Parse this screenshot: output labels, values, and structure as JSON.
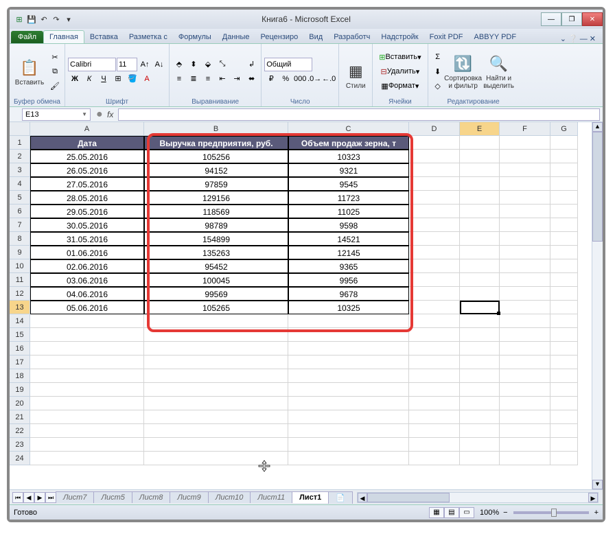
{
  "title": "Книга6 - Microsoft Excel",
  "qat": {
    "save": "💾",
    "undo": "↶",
    "redo": "↷",
    "more": "▾"
  },
  "winbtns": {
    "min": "—",
    "max": "❐",
    "close": "✕"
  },
  "tabs": {
    "file": "Файл",
    "items": [
      "Главная",
      "Вставка",
      "Разметка с",
      "Формулы",
      "Данные",
      "Рецензиро",
      "Вид",
      "Разработч",
      "Надстройк",
      "Foxit PDF",
      "ABBYY PDF"
    ],
    "active": 0,
    "help": "⌄ ❔ — ✕"
  },
  "ribbon": {
    "clipboard": {
      "label": "Буфер обмена",
      "paste": "Вставить",
      "cut": "✂",
      "copy": "⧉",
      "brush": "🖌"
    },
    "font": {
      "label": "Шрифт",
      "name": "Calibri",
      "size": "11",
      "bold": "Ж",
      "italic": "К",
      "underline": "Ч",
      "border": "⊞",
      "fill": "🪣",
      "color": "A",
      "grow": "A↑",
      "shrink": "A↓"
    },
    "align": {
      "label": "Выравнивание",
      "wrap": "↲",
      "merge": "⬌"
    },
    "number": {
      "label": "Число",
      "format": "Общий",
      "currency": "₽",
      "percent": "%",
      "comma": "000",
      "inc": ".0→",
      "dec": "←.0"
    },
    "styles": {
      "label": "",
      "btn": "Стили",
      "cond": "▦"
    },
    "cells": {
      "label": "Ячейки",
      "insert": "Вставить",
      "delete": "Удалить",
      "format": "Формат"
    },
    "editing": {
      "label": "Редактирование",
      "sum": "Σ",
      "fill": "⬇",
      "clear": "◇",
      "sort": "Сортировка\nи фильтр",
      "find": "Найти и\nвыделить"
    }
  },
  "namebox": "E13",
  "fx": "fx",
  "columns": [
    "A",
    "B",
    "C",
    "D",
    "E",
    "F",
    "G"
  ],
  "headers": {
    "A": "Дата",
    "B": "Выручка предприятия, руб.",
    "C": "Объем продаж зерна, т"
  },
  "rows": [
    {
      "n": 1
    },
    {
      "n": 2,
      "A": "25.05.2016",
      "B": "105256",
      "C": "10323"
    },
    {
      "n": 3,
      "A": "26.05.2016",
      "B": "94152",
      "C": "9321"
    },
    {
      "n": 4,
      "A": "27.05.2016",
      "B": "97859",
      "C": "9545"
    },
    {
      "n": 5,
      "A": "28.05.2016",
      "B": "129156",
      "C": "11723"
    },
    {
      "n": 6,
      "A": "29.05.2016",
      "B": "118569",
      "C": "11025"
    },
    {
      "n": 7,
      "A": "30.05.2016",
      "B": "98789",
      "C": "9598"
    },
    {
      "n": 8,
      "A": "31.05.2016",
      "B": "154899",
      "C": "14521"
    },
    {
      "n": 9,
      "A": "01.06.2016",
      "B": "135263",
      "C": "12145"
    },
    {
      "n": 10,
      "A": "02.06.2016",
      "B": "95452",
      "C": "9365"
    },
    {
      "n": 11,
      "A": "03.06.2016",
      "B": "100045",
      "C": "9956"
    },
    {
      "n": 12,
      "A": "04.06.2016",
      "B": "99569",
      "C": "9678"
    },
    {
      "n": 13,
      "A": "05.06.2016",
      "B": "105265",
      "C": "10325"
    }
  ],
  "empty_rows": [
    14,
    15,
    16,
    17,
    18,
    19,
    20,
    21,
    22,
    23,
    24
  ],
  "sheets": {
    "nav": [
      "⏮",
      "◀",
      "▶",
      "⏭"
    ],
    "tabs": [
      "Лист7",
      "Лист5",
      "Лист8",
      "Лист9",
      "Лист10",
      "Лист11",
      "Лист1"
    ],
    "active": 6,
    "add": "+"
  },
  "status": {
    "ready": "Готово",
    "zoom": "100%",
    "minus": "−",
    "plus": "+"
  },
  "active_cell": "E13",
  "chart_data": {
    "type": "table",
    "columns": [
      "Дата",
      "Выручка предприятия, руб.",
      "Объем продаж зерна, т"
    ],
    "data": [
      [
        "25.05.2016",
        105256,
        10323
      ],
      [
        "26.05.2016",
        94152,
        9321
      ],
      [
        "27.05.2016",
        97859,
        9545
      ],
      [
        "28.05.2016",
        129156,
        11723
      ],
      [
        "29.05.2016",
        118569,
        11025
      ],
      [
        "30.05.2016",
        98789,
        9598
      ],
      [
        "31.05.2016",
        154899,
        14521
      ],
      [
        "01.06.2016",
        135263,
        12145
      ],
      [
        "02.06.2016",
        95452,
        9365
      ],
      [
        "03.06.2016",
        100045,
        9956
      ],
      [
        "04.06.2016",
        99569,
        9678
      ],
      [
        "05.06.2016",
        105265,
        10325
      ]
    ]
  }
}
